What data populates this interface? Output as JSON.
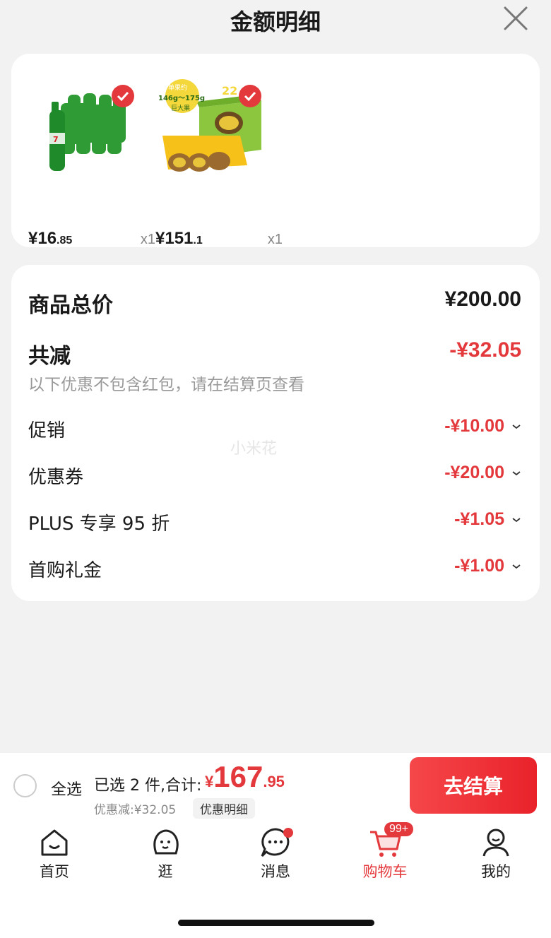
{
  "header": {
    "title": "金额明细"
  },
  "products": [
    {
      "price_int": "¥16",
      "price_dec": ".85",
      "qty": "x1",
      "image": "7up-bottle-pack"
    },
    {
      "price_int": "¥151",
      "price_dec": ".1",
      "qty": "x1",
      "image": "kiwi-gift-box",
      "box_label_1": "单果约",
      "box_label_2": "146g～175g",
      "box_label_3": "巨大果",
      "box_count": "22"
    }
  ],
  "summary": {
    "total_label": "商品总价",
    "total_value": "¥200.00",
    "reduce_label": "共减",
    "reduce_value": "-¥32.05",
    "note": "以下优惠不包含红包，请在结算页查看",
    "discounts": [
      {
        "label": "促销",
        "value": "-¥10.00"
      },
      {
        "label": "优惠券",
        "value": "-¥20.00"
      },
      {
        "label": "PLUS 专享 95 折",
        "value": "-¥1.05"
      },
      {
        "label": "首购礼金",
        "value": "-¥1.00"
      }
    ],
    "watermark": "小米花"
  },
  "bottom": {
    "select_all": "全选",
    "selected_text": "已选 2 件,合计:",
    "sum_currency": "¥",
    "sum_int": "167",
    "sum_dec": ".95",
    "discount_line": "优惠减:¥32.05",
    "detail_button": "优惠明细",
    "checkout": "去结算"
  },
  "tabs": [
    {
      "label": "首页",
      "icon": "home-icon"
    },
    {
      "label": "逛",
      "icon": "face-icon"
    },
    {
      "label": "消息",
      "icon": "message-icon"
    },
    {
      "label": "购物车",
      "icon": "cart-icon",
      "badge": "99+"
    },
    {
      "label": "我的",
      "icon": "user-icon"
    }
  ],
  "colors": {
    "accent": "#e4393c",
    "background": "#f2f2f2"
  }
}
